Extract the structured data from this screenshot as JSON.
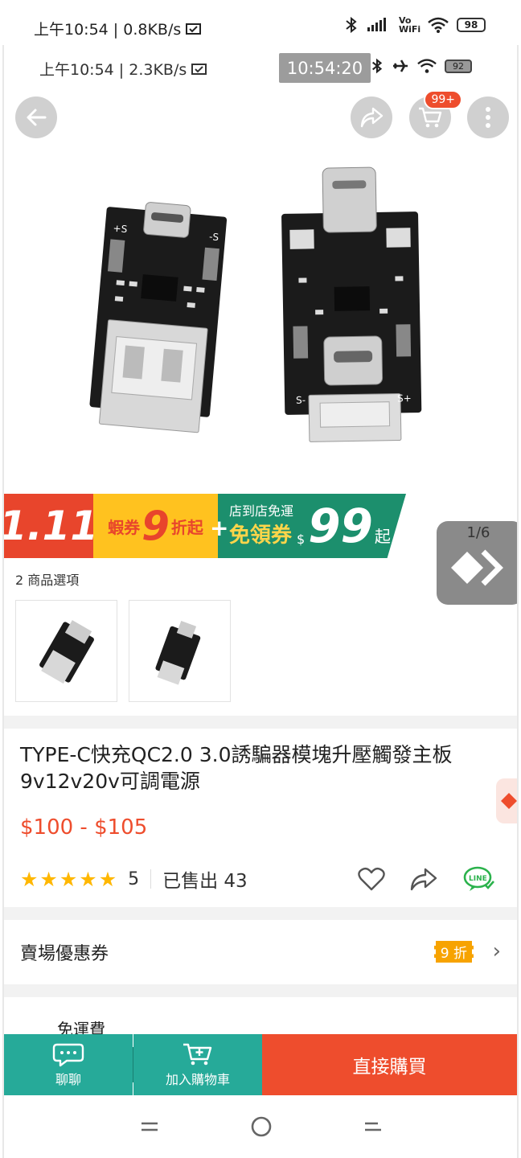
{
  "system_status": {
    "time": "上午10:54",
    "net_speed": "0.8KB/s",
    "signal_label": "Vo WiFi",
    "battery": "98"
  },
  "inner_status": {
    "time": "上午10:54",
    "net_speed": "2.3KB/s",
    "clock": "10:54:20",
    "battery": "92"
  },
  "header": {
    "back_icon": "arrow-left-icon",
    "share_icon": "share-icon",
    "cart_icon": "cart-icon",
    "cart_badge": "99+",
    "more_icon": "more-vertical-icon"
  },
  "gallery": {
    "pager": "1/6"
  },
  "promo_banner": {
    "date": "1.11",
    "coupon_prefix": "蝦券",
    "discount_num": "9",
    "discount_suffix": "折起",
    "plus": "+",
    "free_ship_line": "店到店免運",
    "free_ship_coupon": "免領券",
    "currency": "$",
    "amount": "99",
    "suffix": "起"
  },
  "options": {
    "label": "2 商品選項",
    "count": 2
  },
  "product": {
    "title": "TYPE-C快充QC2.0 3.0誘騙器模塊升壓觸發主板9v12v20v可調電源",
    "price": "$100 - $105",
    "rating": "5",
    "rating_value": 5,
    "sold": "已售出 43"
  },
  "coupon": {
    "label": "賣場優惠券",
    "badge": "9 折"
  },
  "shipping": {
    "label": "免運費"
  },
  "bottom_bar": {
    "chat_label": "聊聊",
    "add_cart_label": "加入購物車",
    "buy_label": "直接購買"
  },
  "colors": {
    "brand": "#ee4d2d",
    "teal": "#26aa99",
    "star": "#ffb700",
    "promo_green": "#1c8f6d",
    "promo_yellow": "#ffc21f"
  }
}
